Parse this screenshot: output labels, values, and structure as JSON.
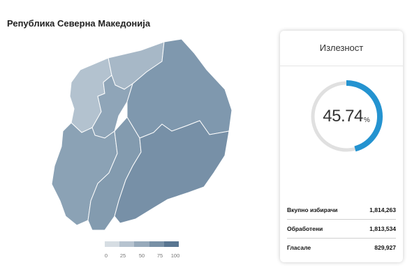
{
  "page": {
    "title": "Република Северна Македонија"
  },
  "legend": {
    "colors": [
      "#d6dde3",
      "#b6c3cf",
      "#97aabb",
      "#7890a6",
      "#597691"
    ],
    "ticks": [
      "0",
      "25",
      "50",
      "75",
      "100"
    ]
  },
  "card": {
    "title": "Излезност",
    "turnout_value": "45.74",
    "turnout_unit": "%",
    "turnout_fraction": 0.4574,
    "stats": [
      {
        "label": "Вкупно избирачи",
        "value": "1,814,263"
      },
      {
        "label": "Обработени",
        "value": "1,813,534"
      },
      {
        "label": "Гласале",
        "value": "829,927"
      }
    ],
    "accent_color": "#2493d0",
    "track_color": "#e0e0e0"
  }
}
